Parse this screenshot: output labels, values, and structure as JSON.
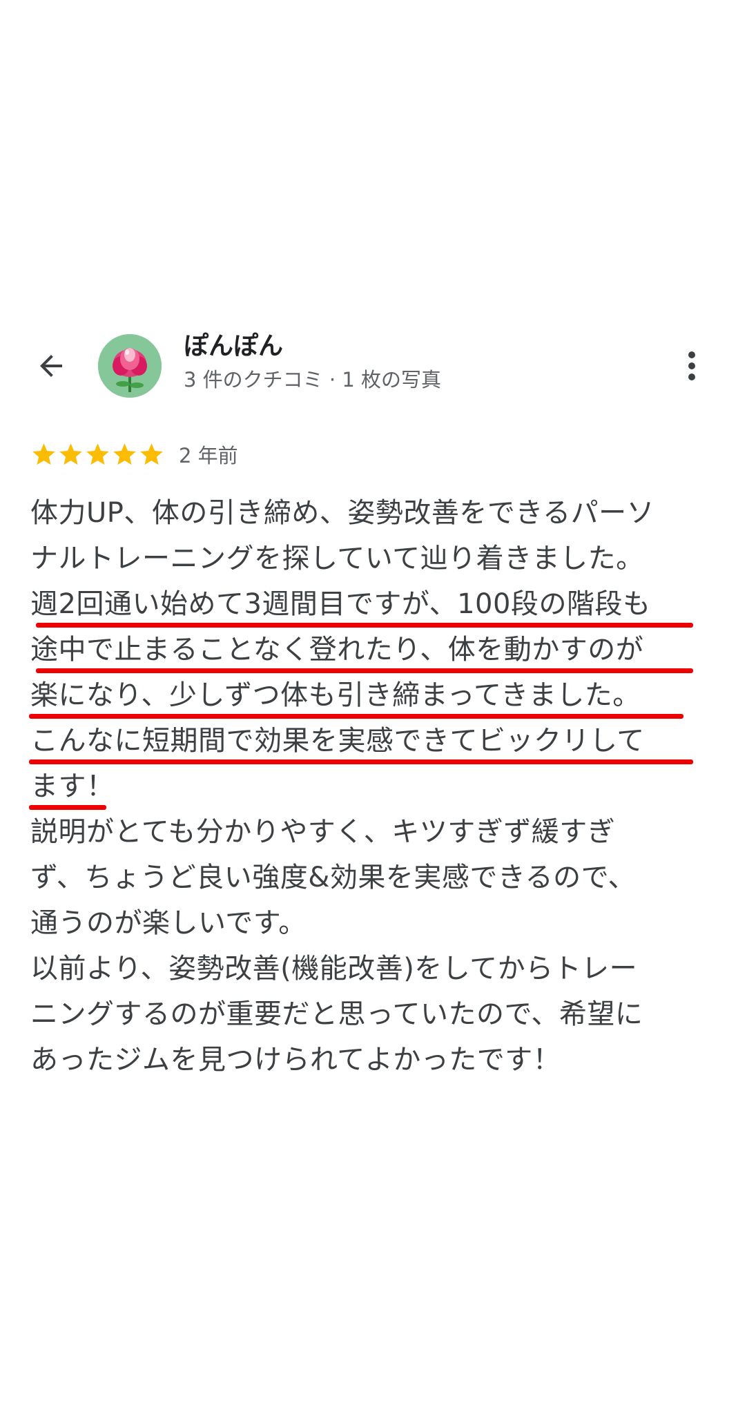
{
  "reviewer": {
    "name": "ぽんぽん",
    "meta": "3 件のクチコミ · 1 枚の写真"
  },
  "review": {
    "rating": 5,
    "max_rating": 5,
    "time_ago": "2 年前",
    "star_color": "#fbbc04",
    "lines": [
      "体力UP、体の引き締め、姿勢改善をできるパーソ",
      "ナルトレーニングを探していて辿り着きました。",
      "週2回通い始めて3週間目ですが、100段の階段も",
      "途中で止まることなく登れたり、体を動かすのが",
      "楽になり、少しずつ体も引き締まってきました。",
      "こんなに短期間で効果を実感できてビックリして",
      "ます！",
      "説明がとても分かりやすく、キツすぎず緩すぎ",
      "ず、ちょうど良い強度&効果を実感できるので、",
      "通うのが楽しいです。",
      "以前より、姿勢改善(機能改善)をしてからトレー",
      "ニングするのが重要だと思っていたので、希望に",
      "あったジムを見つけられてよかったです！"
    ],
    "highlight_color": "#ee0000"
  },
  "icons": {
    "back": "arrow-back-icon",
    "more": "more-vert-icon",
    "avatar": "lotus-flower-avatar"
  }
}
